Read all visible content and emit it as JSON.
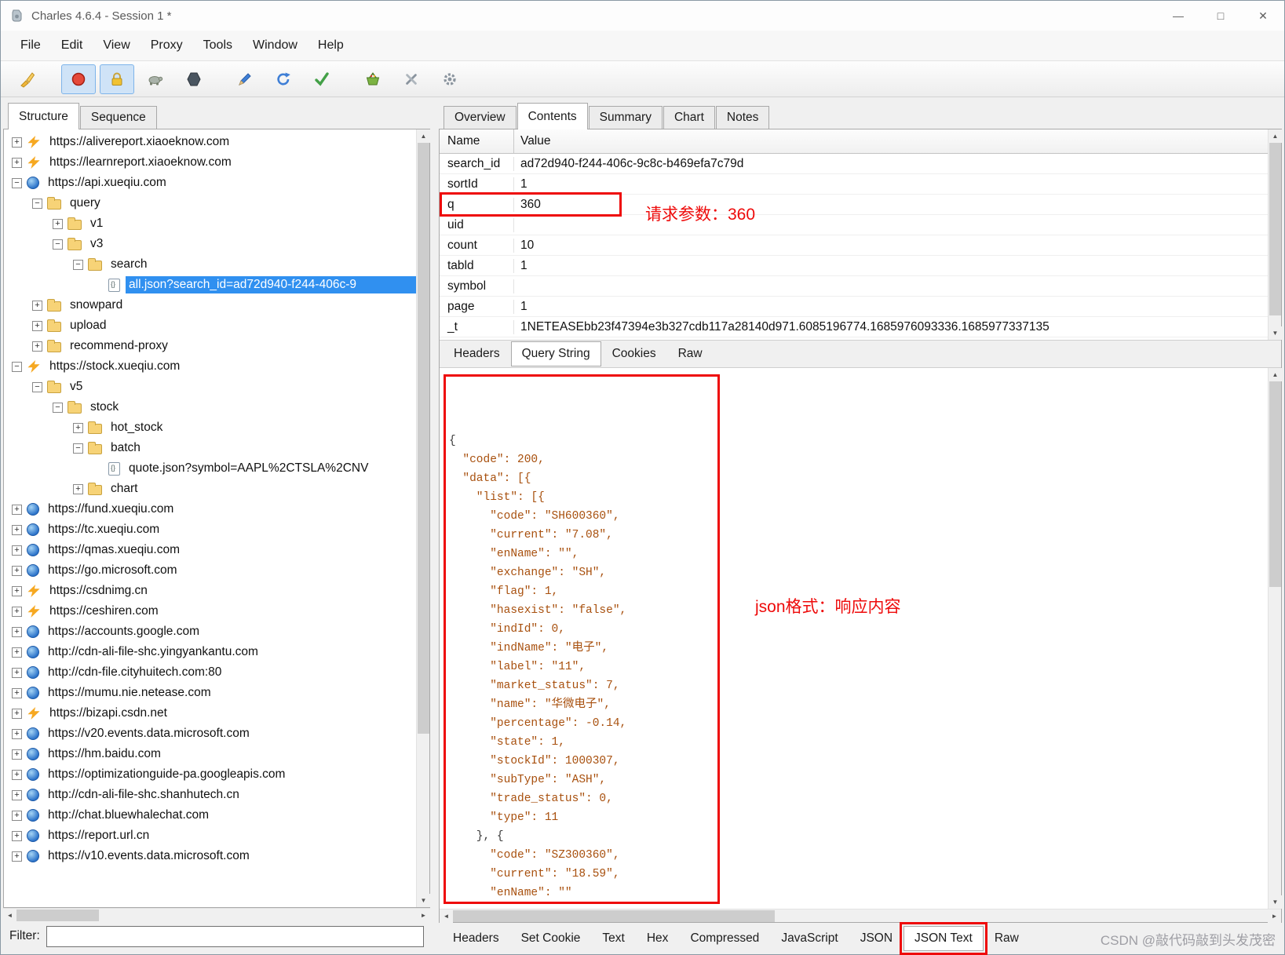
{
  "window": {
    "title": "Charles 4.6.4 - Session 1 *",
    "controls": [
      {
        "name": "minimize",
        "glyph": "—"
      },
      {
        "name": "maximize",
        "glyph": "□"
      },
      {
        "name": "close",
        "glyph": "✕"
      }
    ]
  },
  "menu": {
    "items": [
      "File",
      "Edit",
      "View",
      "Proxy",
      "Tools",
      "Window",
      "Help"
    ]
  },
  "toolbar": {
    "icons": [
      "clear-broom",
      "record",
      "ssl-lock",
      "throttle-turtle",
      "breakpoints-hexagon",
      "compose-pencil",
      "repeat-refresh",
      "validate-check",
      "publish-basket",
      "tools-wrench",
      "settings-gear"
    ]
  },
  "left_panel": {
    "tabs": [
      {
        "label": "Structure",
        "cls": "active"
      },
      {
        "label": "Sequence",
        "cls": ""
      }
    ],
    "filter_label": "Filter:",
    "filter_value": "",
    "tree": [
      {
        "indent": 0,
        "exp": "plus",
        "icon": "lightning",
        "label": "https://alivereport.xiaoeknow.com",
        "cls": ""
      },
      {
        "indent": 0,
        "exp": "plus",
        "icon": "lightning",
        "label": "https://learnreport.xiaoeknow.com",
        "cls": ""
      },
      {
        "indent": 0,
        "exp": "minus",
        "icon": "globe",
        "label": "https://api.xueqiu.com",
        "cls": ""
      },
      {
        "indent": 1,
        "exp": "minus",
        "icon": "folder",
        "label": "query",
        "cls": ""
      },
      {
        "indent": 2,
        "exp": "plus",
        "icon": "folder",
        "label": "v1",
        "cls": ""
      },
      {
        "indent": 2,
        "exp": "minus",
        "icon": "folder",
        "label": "v3",
        "cls": ""
      },
      {
        "indent": 3,
        "exp": "minus",
        "icon": "folder",
        "label": "search",
        "cls": ""
      },
      {
        "indent": 4,
        "exp": "none",
        "icon": "doc",
        "label": "all.json?search_id=ad72d940-f244-406c-9",
        "cls": "selected"
      },
      {
        "indent": 1,
        "exp": "plus",
        "icon": "folder",
        "label": "snowpard",
        "cls": ""
      },
      {
        "indent": 1,
        "exp": "plus",
        "icon": "folder",
        "label": "upload",
        "cls": ""
      },
      {
        "indent": 1,
        "exp": "plus",
        "icon": "folder",
        "label": "recommend-proxy",
        "cls": ""
      },
      {
        "indent": 0,
        "exp": "minus",
        "icon": "lightning",
        "label": "https://stock.xueqiu.com",
        "cls": ""
      },
      {
        "indent": 1,
        "exp": "minus",
        "icon": "folder",
        "label": "v5",
        "cls": ""
      },
      {
        "indent": 2,
        "exp": "minus",
        "icon": "folder",
        "label": "stock",
        "cls": ""
      },
      {
        "indent": 3,
        "exp": "plus",
        "icon": "folder",
        "label": "hot_stock",
        "cls": ""
      },
      {
        "indent": 3,
        "exp": "minus",
        "icon": "folder",
        "label": "batch",
        "cls": ""
      },
      {
        "indent": 4,
        "exp": "none",
        "icon": "doc",
        "label": "quote.json?symbol=AAPL%2CTSLA%2CNV",
        "cls": ""
      },
      {
        "indent": 3,
        "exp": "plus",
        "icon": "folder",
        "label": "chart",
        "cls": ""
      },
      {
        "indent": 0,
        "exp": "plus",
        "icon": "globe",
        "label": "https://fund.xueqiu.com",
        "cls": ""
      },
      {
        "indent": 0,
        "exp": "plus",
        "icon": "globe",
        "label": "https://tc.xueqiu.com",
        "cls": ""
      },
      {
        "indent": 0,
        "exp": "plus",
        "icon": "globe",
        "label": "https://qmas.xueqiu.com",
        "cls": ""
      },
      {
        "indent": 0,
        "exp": "plus",
        "icon": "globe",
        "label": "https://go.microsoft.com",
        "cls": ""
      },
      {
        "indent": 0,
        "exp": "plus",
        "icon": "lightning",
        "label": "https://csdnimg.cn",
        "cls": ""
      },
      {
        "indent": 0,
        "exp": "plus",
        "icon": "lightning",
        "label": "https://ceshiren.com",
        "cls": ""
      },
      {
        "indent": 0,
        "exp": "plus",
        "icon": "globe",
        "label": "https://accounts.google.com",
        "cls": ""
      },
      {
        "indent": 0,
        "exp": "plus",
        "icon": "globe",
        "label": "http://cdn-ali-file-shc.yingyankantu.com",
        "cls": ""
      },
      {
        "indent": 0,
        "exp": "plus",
        "icon": "globe",
        "label": "http://cdn-file.cityhuitech.com:80",
        "cls": ""
      },
      {
        "indent": 0,
        "exp": "plus",
        "icon": "globe",
        "label": "https://mumu.nie.netease.com",
        "cls": ""
      },
      {
        "indent": 0,
        "exp": "plus",
        "icon": "lightning",
        "label": "https://bizapi.csdn.net",
        "cls": ""
      },
      {
        "indent": 0,
        "exp": "plus",
        "icon": "globe",
        "label": "https://v20.events.data.microsoft.com",
        "cls": ""
      },
      {
        "indent": 0,
        "exp": "plus",
        "icon": "globe",
        "label": "https://hm.baidu.com",
        "cls": ""
      },
      {
        "indent": 0,
        "exp": "plus",
        "icon": "globe",
        "label": "https://optimizationguide-pa.googleapis.com",
        "cls": ""
      },
      {
        "indent": 0,
        "exp": "plus",
        "icon": "globe",
        "label": "http://cdn-ali-file-shc.shanhutech.cn",
        "cls": ""
      },
      {
        "indent": 0,
        "exp": "plus",
        "icon": "globe",
        "label": "http://chat.bluewhalechat.com",
        "cls": ""
      },
      {
        "indent": 0,
        "exp": "plus",
        "icon": "globe",
        "label": "https://report.url.cn",
        "cls": ""
      },
      {
        "indent": 0,
        "exp": "plus",
        "icon": "globe",
        "label": "https://v10.events.data.microsoft.com",
        "cls": ""
      }
    ]
  },
  "right_panel": {
    "tabs": [
      {
        "label": "Overview",
        "cls": ""
      },
      {
        "label": "Contents",
        "cls": "active"
      },
      {
        "label": "Summary",
        "cls": ""
      },
      {
        "label": "Chart",
        "cls": ""
      },
      {
        "label": "Notes",
        "cls": ""
      }
    ],
    "query_table": {
      "columns": [
        "Name",
        "Value"
      ],
      "rows": [
        {
          "name": "search_id",
          "value": "ad72d940-f244-406c-9c8c-b469efa7c79d",
          "cls": ""
        },
        {
          "name": "sortId",
          "value": "1",
          "cls": ""
        },
        {
          "name": "q",
          "value": "360",
          "cls": "hl"
        },
        {
          "name": "uid",
          "value": "",
          "cls": ""
        },
        {
          "name": "count",
          "value": "10",
          "cls": ""
        },
        {
          "name": "tabld",
          "value": "1",
          "cls": ""
        },
        {
          "name": "symbol",
          "value": "",
          "cls": ""
        },
        {
          "name": "page",
          "value": "1",
          "cls": ""
        },
        {
          "name": "_t",
          "value": "1NETEASEbb23f47394e3b327cdb117a28140d971.6085196774.1685976093336.1685977337135",
          "cls": ""
        }
      ]
    },
    "request_tabs": [
      {
        "label": "Headers",
        "cls": ""
      },
      {
        "label": "Query String",
        "cls": "active"
      },
      {
        "label": "Cookies",
        "cls": ""
      },
      {
        "label": "Raw",
        "cls": ""
      }
    ],
    "response_lines": [
      {
        "tone": "plain",
        "text": "{"
      },
      {
        "tone": "code",
        "text": "  \"code\": 200,"
      },
      {
        "tone": "code",
        "text": "  \"data\": [{"
      },
      {
        "tone": "code",
        "text": "    \"list\": [{"
      },
      {
        "tone": "code",
        "text": "      \"code\": \"SH600360\","
      },
      {
        "tone": "code",
        "text": "      \"current\": \"7.08\","
      },
      {
        "tone": "code",
        "text": "      \"enName\": \"\","
      },
      {
        "tone": "code",
        "text": "      \"exchange\": \"SH\","
      },
      {
        "tone": "code",
        "text": "      \"flag\": 1,"
      },
      {
        "tone": "code",
        "text": "      \"hasexist\": \"false\","
      },
      {
        "tone": "code",
        "text": "      \"indId\": 0,"
      },
      {
        "tone": "code",
        "text": "      \"indName\": \"电子\","
      },
      {
        "tone": "code",
        "text": "      \"label\": \"11\","
      },
      {
        "tone": "code",
        "text": "      \"market_status\": 7,"
      },
      {
        "tone": "code",
        "text": "      \"name\": \"华微电子\","
      },
      {
        "tone": "code",
        "text": "      \"percentage\": -0.14,"
      },
      {
        "tone": "code",
        "text": "      \"state\": 1,"
      },
      {
        "tone": "code",
        "text": "      \"stockId\": 1000307,"
      },
      {
        "tone": "code",
        "text": "      \"subType\": \"ASH\","
      },
      {
        "tone": "code",
        "text": "      \"trade_status\": 0,"
      },
      {
        "tone": "code",
        "text": "      \"type\": 11"
      },
      {
        "tone": "plain",
        "text": "    }, {"
      },
      {
        "tone": "code",
        "text": "      \"code\": \"SZ300360\","
      },
      {
        "tone": "code",
        "text": "      \"current\": \"18.59\","
      },
      {
        "tone": "code",
        "text": "      \"enName\": \"\""
      }
    ],
    "response_tabs": [
      {
        "label": "Headers",
        "cls": ""
      },
      {
        "label": "Set Cookie",
        "cls": ""
      },
      {
        "label": "Text",
        "cls": ""
      },
      {
        "label": "Hex",
        "cls": ""
      },
      {
        "label": "Compressed",
        "cls": ""
      },
      {
        "label": "JavaScript",
        "cls": ""
      },
      {
        "label": "JSON",
        "cls": ""
      },
      {
        "label": "JSON Text",
        "cls": "active redbox"
      },
      {
        "label": "Raw",
        "cls": ""
      }
    ],
    "annotations": {
      "query_param": "请求参数：360",
      "json_response": "json格式：响应内容"
    },
    "watermark": "CSDN @敲代码敲到头发茂密"
  }
}
